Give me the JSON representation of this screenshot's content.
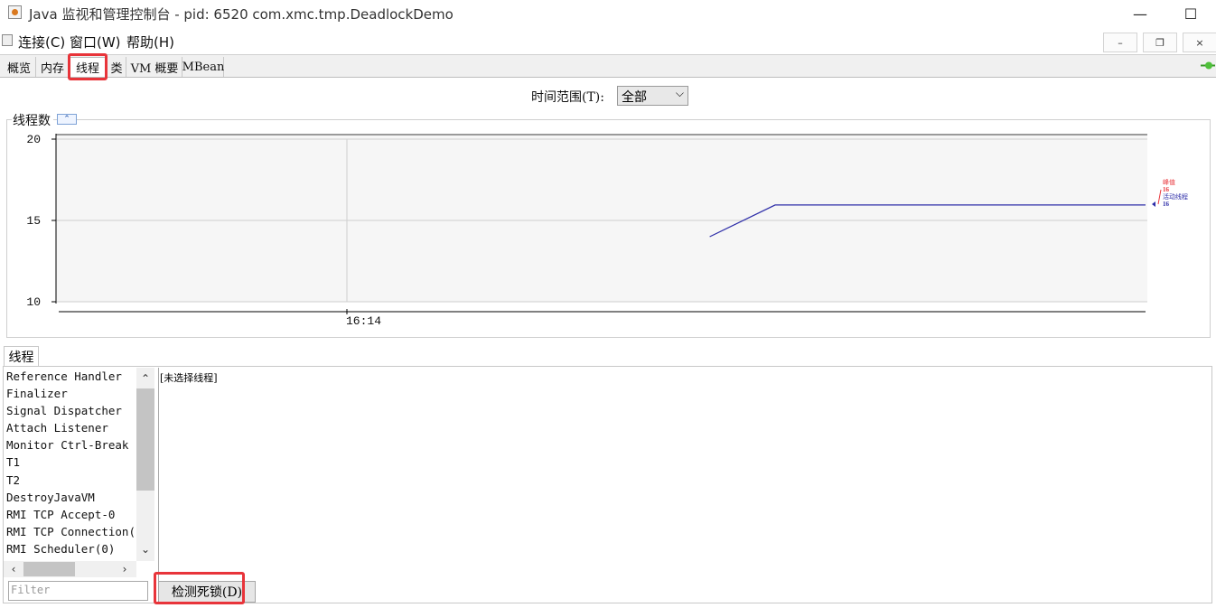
{
  "window": {
    "title": "Java 监视和管理控制台 - pid: 6520 com.xmc.tmp.DeadlockDemo",
    "controls": {
      "minimize": "—",
      "maximize": "☐",
      "close": "✕"
    }
  },
  "menu": {
    "items": [
      "连接(C)",
      "窗口(W)",
      "帮助(H)"
    ],
    "mdi_controls": {
      "minimize": "–",
      "restore": "❐",
      "close": "×"
    }
  },
  "tabs": [
    "概览",
    "内存",
    "线程",
    "类",
    "VM 概要",
    "MBean"
  ],
  "active_tab": "线程",
  "time_range": {
    "label": "时间范围(T):",
    "value": "全部"
  },
  "chart_panel": {
    "title": "线程数",
    "collapse_icon": "chevron-up-icon"
  },
  "chart_data": {
    "type": "line",
    "title": "线程数",
    "y_ticks": [
      "20",
      "15",
      "10"
    ],
    "ylim": [
      10,
      20
    ],
    "x_tick": "16:14",
    "series": [
      {
        "name": "峰值",
        "value": "16",
        "color": "#e8343a"
      },
      {
        "name": "活动线程",
        "value": "16",
        "color": "#2d2da8"
      }
    ],
    "points": [
      {
        "x": 0.6,
        "y": 14.0
      },
      {
        "x": 0.66,
        "y": 15.95
      },
      {
        "x": 1.0,
        "y": 15.95
      }
    ],
    "grid": true,
    "legend_position": "right"
  },
  "threads_panel": {
    "tab_label": "线程",
    "threads": [
      "Reference Handler",
      "Finalizer",
      "Signal Dispatcher",
      "Attach Listener",
      "Monitor Ctrl-Break",
      "T1",
      "T2",
      "DestroyJavaVM",
      "RMI TCP Accept-0",
      "RMI TCP Connection(",
      "RMI Scheduler(0)"
    ],
    "detail_text": "[未选择线程]",
    "filter_placeholder": "Filter",
    "detect_deadlock_label": "检测死锁(D)"
  },
  "colors": {
    "highlight": "#e8343a",
    "accent": "#2d2da8"
  }
}
